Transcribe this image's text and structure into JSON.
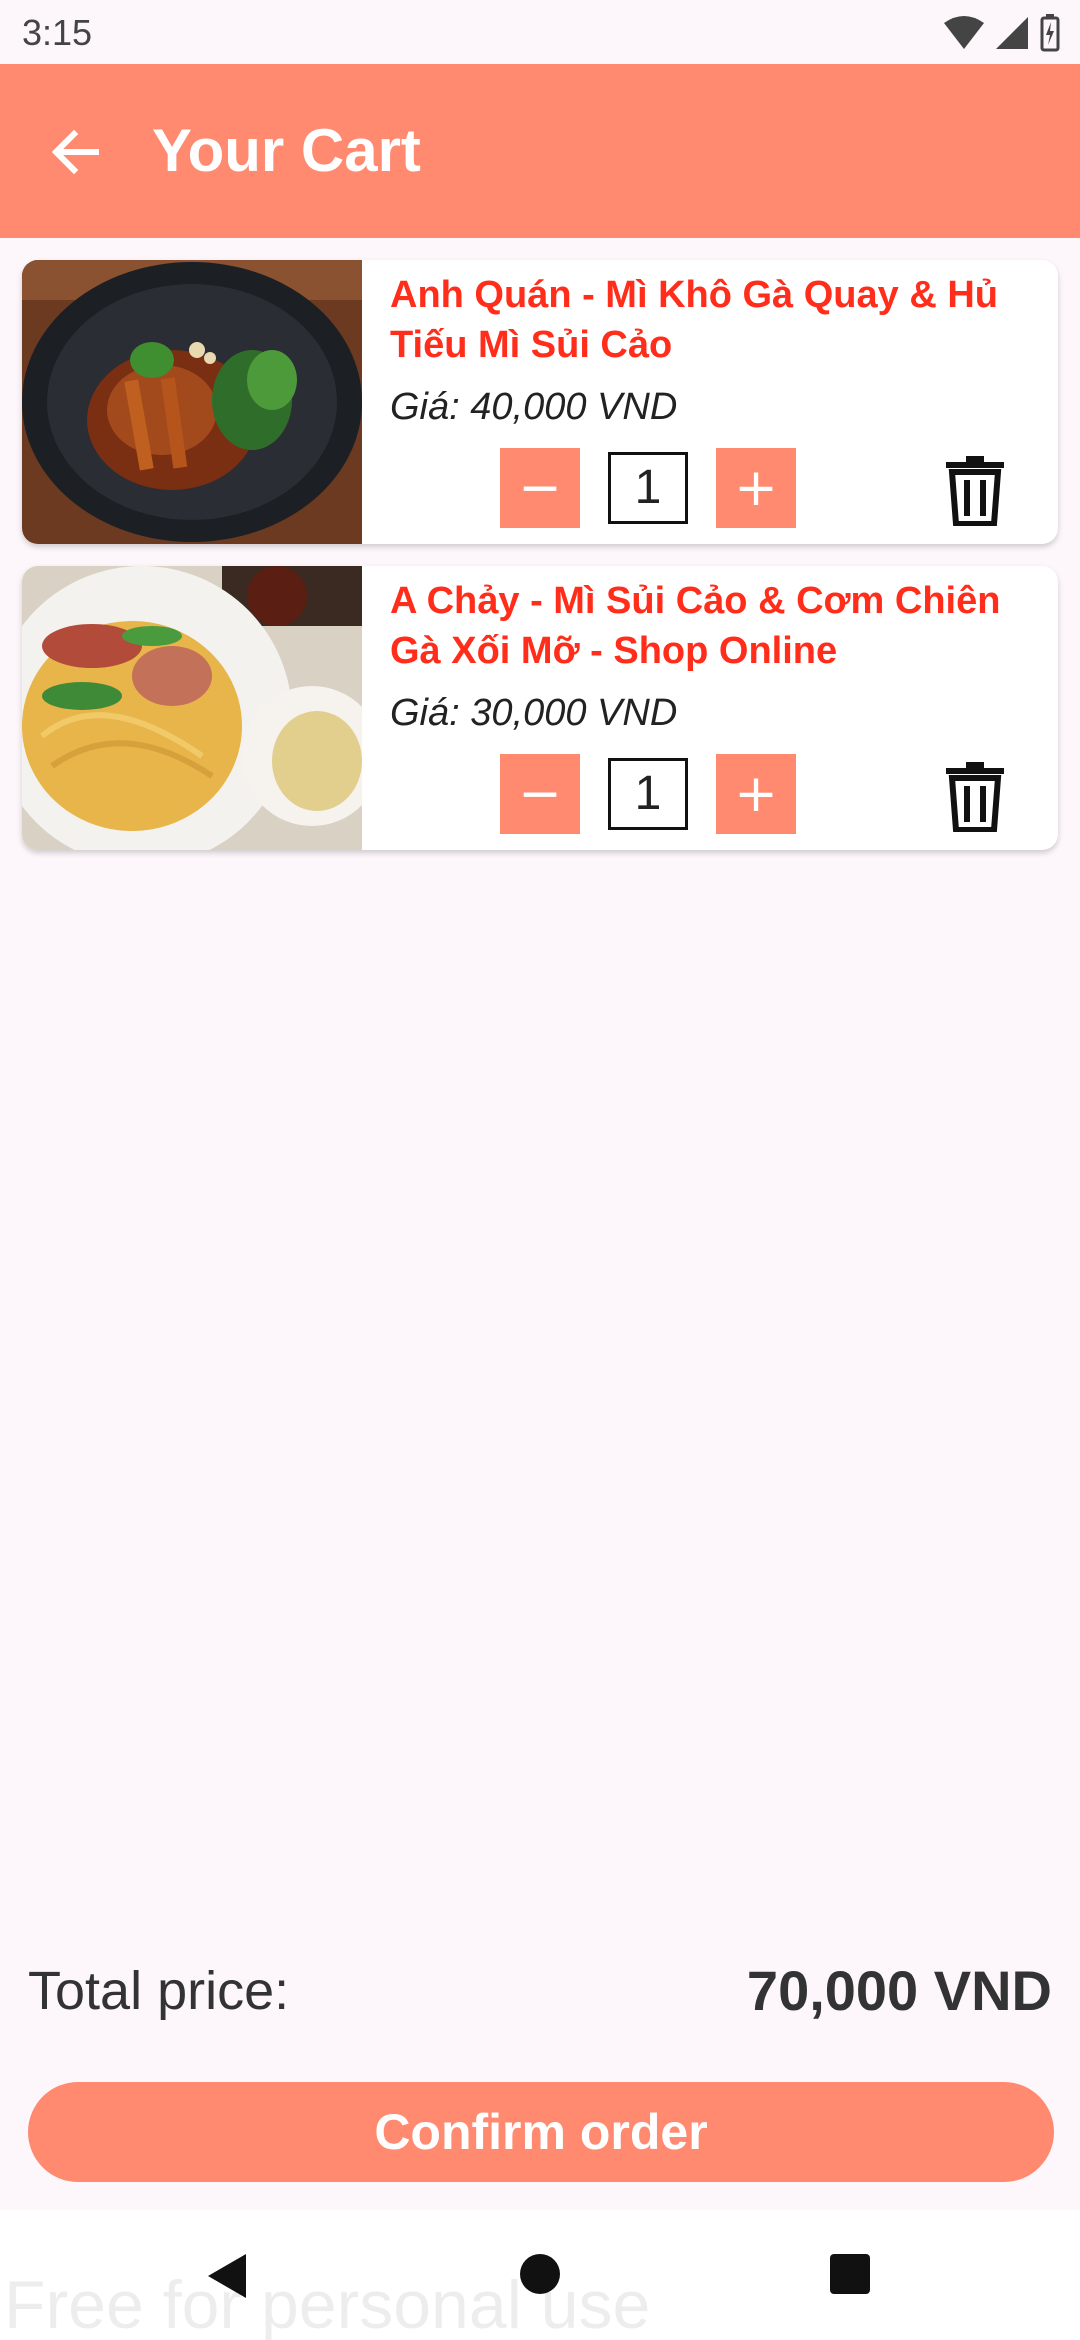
{
  "status_bar": {
    "time": "3:15",
    "icons": [
      "wifi-icon",
      "cell-signal-icon",
      "battery-charging-icon"
    ]
  },
  "app_bar": {
    "title": "Your Cart",
    "back_icon": "arrow-left-icon",
    "background": "#ff8a70"
  },
  "cart": {
    "items": [
      {
        "name": "Anh Quán - Mì Khô Gà Quay & Hủ Tiếu Mì Sủi Cảo",
        "price": "Giá: 40,000 VND",
        "quantity": "1",
        "minus_label": "−",
        "plus_label": "+",
        "image": "roast-chicken-noodle-photo"
      },
      {
        "name": "A Chảy - Mì Sủi Cảo & Cơm Chiên Gà Xối Mỡ - Shop Online",
        "price": "Giá: 30,000 VND",
        "quantity": "1",
        "minus_label": "−",
        "plus_label": "+",
        "image": "wonton-noodle-photo"
      }
    ]
  },
  "footer": {
    "total_label": "Total price:",
    "total_value": "70,000 VND",
    "confirm_label": "Confirm order"
  },
  "nav_bar": {
    "icons": [
      "nav-back-icon",
      "nav-home-icon",
      "nav-recent-icon"
    ]
  },
  "watermark": "Free for personal use",
  "colors": {
    "accent": "#ff8a70",
    "item_name": "#ff2d1a",
    "background": "#fdf7fb"
  }
}
